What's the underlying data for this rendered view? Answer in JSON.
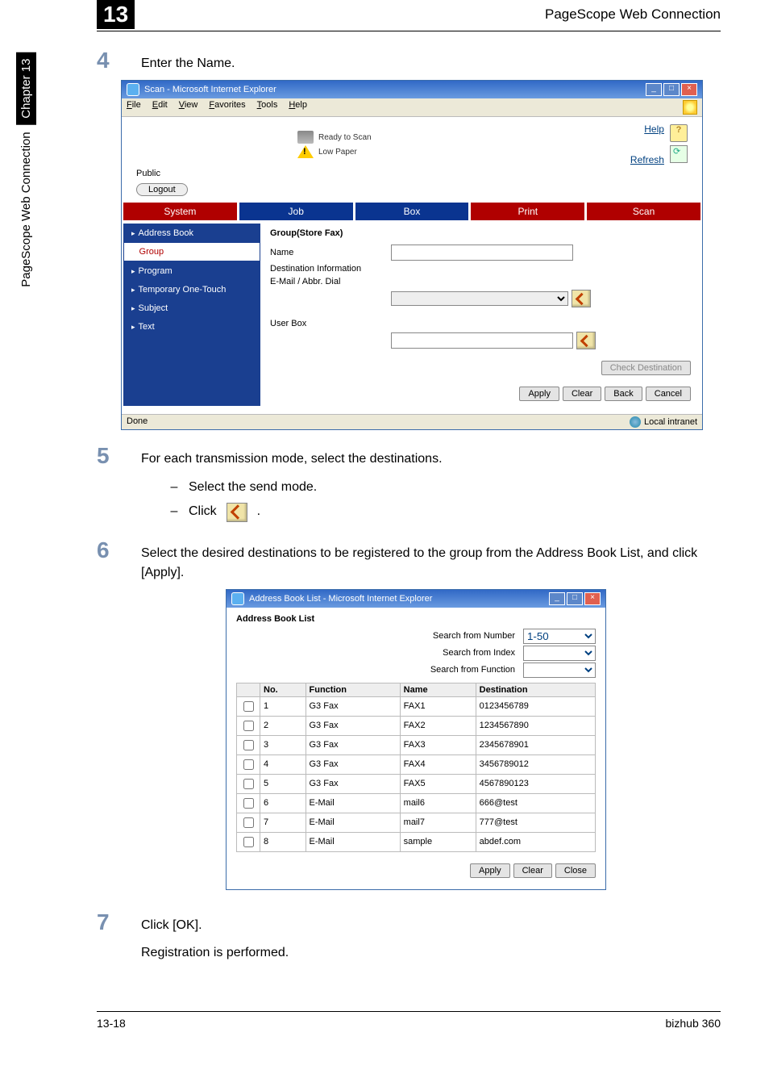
{
  "sidebar": {
    "chapter": "Chapter 13",
    "section": "PageScope Web Connection"
  },
  "header": {
    "chapter_num": "13",
    "title": "PageScope Web Connection"
  },
  "steps": {
    "s4": {
      "num": "4",
      "text": "Enter the Name."
    },
    "s5": {
      "num": "5",
      "text": "For each transmission mode, select the destinations.",
      "sub1": "Select the send mode.",
      "sub2_pre": "Click",
      "sub2_post": "."
    },
    "s6": {
      "num": "6",
      "text": "Select the desired destinations to be registered to the group from the Address Book List, and click [Apply]."
    },
    "s7": {
      "num": "7",
      "text": "Click [OK].",
      "text2": "Registration is performed."
    }
  },
  "ie": {
    "title": "Scan - Microsoft Internet Explorer",
    "menus": [
      "File",
      "Edit",
      "View",
      "Favorites",
      "Tools",
      "Help"
    ],
    "status": {
      "ready": "Ready to Scan",
      "low": "Low Paper"
    },
    "links": {
      "help": "Help",
      "refresh": "Refresh"
    },
    "mode": "Public",
    "logout": "Logout",
    "tabs": [
      "System",
      "Job",
      "Box",
      "Print",
      "Scan"
    ],
    "nav": [
      "Address Book",
      "Group",
      "Program",
      "Temporary One-Touch",
      "Subject",
      "Text"
    ],
    "panel": {
      "title": "Group(Store Fax)",
      "name_label": "Name",
      "dest_label": "Destination Information",
      "mode_label": "E-Mail / Abbr. Dial",
      "userbox_label": "User Box",
      "check": "Check Destination",
      "apply": "Apply",
      "clear": "Clear",
      "back": "Back",
      "cancel": "Cancel"
    },
    "statusbar": {
      "done": "Done",
      "zone": "Local intranet"
    }
  },
  "dialog": {
    "title": "Address Book List - Microsoft Internet Explorer",
    "heading": "Address Book List",
    "search_num": "Search from Number",
    "search_num_val": "1-50",
    "search_idx": "Search from Index",
    "search_fn": "Search from Function",
    "cols": {
      "no": "No.",
      "function": "Function",
      "name": "Name",
      "dest": "Destination"
    },
    "rows": [
      {
        "no": "1",
        "fn": "G3 Fax",
        "name": "FAX1",
        "dest": "0123456789"
      },
      {
        "no": "2",
        "fn": "G3 Fax",
        "name": "FAX2",
        "dest": "1234567890"
      },
      {
        "no": "3",
        "fn": "G3 Fax",
        "name": "FAX3",
        "dest": "2345678901"
      },
      {
        "no": "4",
        "fn": "G3 Fax",
        "name": "FAX4",
        "dest": "3456789012"
      },
      {
        "no": "5",
        "fn": "G3 Fax",
        "name": "FAX5",
        "dest": "4567890123"
      },
      {
        "no": "6",
        "fn": "E-Mail",
        "name": "mail6",
        "dest": "666@test"
      },
      {
        "no": "7",
        "fn": "E-Mail",
        "name": "mail7",
        "dest": "777@test"
      },
      {
        "no": "8",
        "fn": "E-Mail",
        "name": "sample",
        "dest": "abdef.com"
      }
    ],
    "apply": "Apply",
    "clear": "Clear",
    "close": "Close"
  },
  "footer": {
    "left": "13-18",
    "right": "bizhub 360"
  }
}
